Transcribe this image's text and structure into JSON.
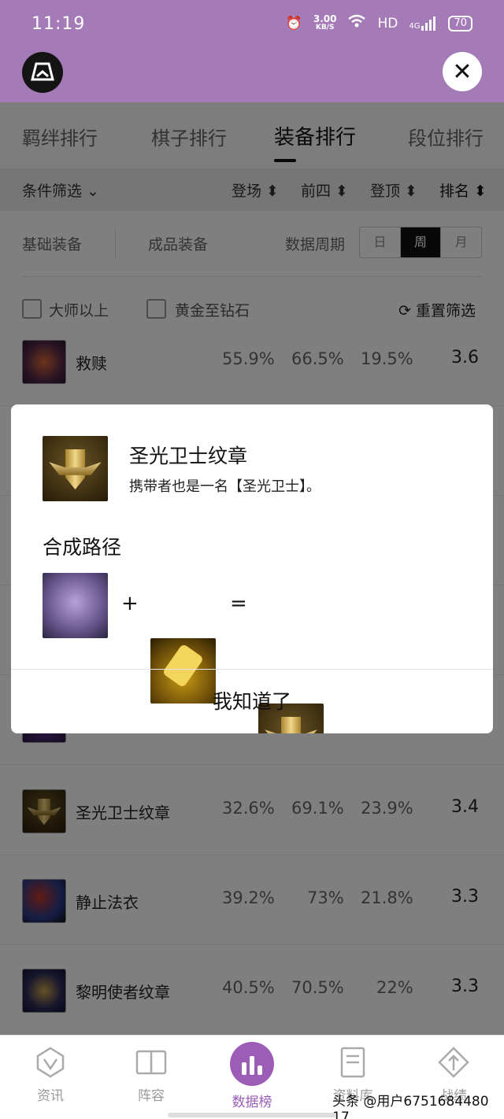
{
  "status_bar": {
    "time": "11:19",
    "net_speed": "3.00",
    "net_unit": "KB/S",
    "hd": "HD",
    "signal": "4G",
    "battery": "70"
  },
  "tabs": [
    "羁绊排行",
    "棋子排行",
    "装备排行",
    "段位排行"
  ],
  "active_tab": "装备排行",
  "filter": {
    "condition": "条件筛选",
    "cols": [
      "登场",
      "前四",
      "登顶",
      "排名"
    ]
  },
  "category": {
    "basic": "基础装备",
    "finished": "成品装备",
    "period_label": "数据周期",
    "periods": [
      "日",
      "周",
      "月"
    ],
    "selected_period": "周"
  },
  "checks": {
    "master": "大师以上",
    "gold_diamond": "黄金至钻石",
    "reset": "重置筛选"
  },
  "items": [
    {
      "name": "救赎",
      "play": "55.9%",
      "top4": "66.5%",
      "top1": "19.5%",
      "rank": "3.6",
      "icon": "redemption-icon"
    },
    {
      "name": "圣光卫士纹章",
      "play": "32.6%",
      "top4": "69.1%",
      "top1": "23.9%",
      "rank": "3.4",
      "icon": "emblem-icon"
    },
    {
      "name": "静止法衣",
      "play": "39.2%",
      "top4": "73%",
      "top1": "21.8%",
      "rank": "3.3",
      "icon": "shroud-icon"
    },
    {
      "name": "黎明使者纹章",
      "play": "40.5%",
      "top4": "70.5%",
      "top1": "22%",
      "rank": "3.3",
      "icon": "dawnbringer-emblem-icon"
    }
  ],
  "modal": {
    "title": "圣光卫士纹章",
    "desc": "携带者也是一名【圣光卫士】。",
    "recipe_label": "合成路径",
    "plus": "+",
    "equals": "=",
    "ok": "我知道了"
  },
  "nav": [
    "资讯",
    "阵容",
    "数据榜",
    "资料库",
    "战绩"
  ],
  "active_nav": "数据榜",
  "watermark": "头条 @用户6751684480 17",
  "colors": {
    "header": "#a57bb7",
    "accent": "#9b5db6"
  }
}
